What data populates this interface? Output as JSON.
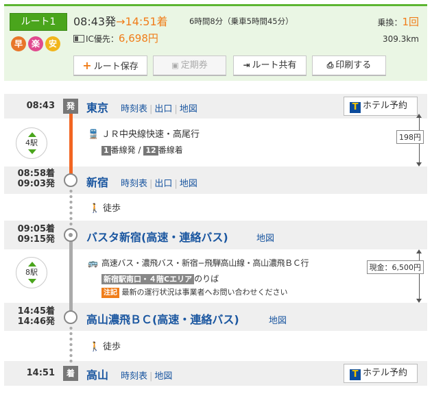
{
  "summary": {
    "route_label": "ルート1",
    "marks": [
      {
        "char": "早",
        "color": "#e8762b"
      },
      {
        "char": "楽",
        "color": "#e04a8e"
      },
      {
        "char": "安",
        "color": "#f1b51c"
      }
    ],
    "depart_time": "08:43発",
    "arrow": "→",
    "arrive_time": "14:51着",
    "duration": "6時間8分（乗車5時間45分）",
    "ic_label": "IC優先：",
    "fare": "6,698円",
    "transfer_label": "乗換：",
    "transfer_count": "1回",
    "distance": "309.3km"
  },
  "actions": {
    "save": "ルート保存",
    "pass": "定期券",
    "share": "ルート共有",
    "print": "印刷する"
  },
  "stations": [
    {
      "time": "08:43",
      "mark": "発",
      "name": "東京",
      "links": [
        "時刻表",
        "出口",
        "地図"
      ],
      "hotel": "ホテル予約"
    },
    {
      "arr": "08:58着",
      "dep": "09:03発",
      "name": "新宿",
      "links": [
        "時刻表",
        "出口",
        "地図"
      ]
    },
    {
      "arr": "09:05着",
      "dep": "09:15発",
      "name": "バスタ新宿(高速・連絡バス)",
      "links": [
        "地図"
      ]
    },
    {
      "arr": "14:45着",
      "dep": "14:46発",
      "name": "高山濃飛ＢＣ(高速・連絡バス)",
      "links": [
        "地図"
      ]
    },
    {
      "time": "14:51",
      "mark": "着",
      "name": "高山",
      "links": [
        "時刻表",
        "地図"
      ],
      "hotel": "ホテル予約"
    }
  ],
  "legs": {
    "train": {
      "stops": "4駅",
      "name": "ＪＲ中央線快速・高尾行",
      "dep_platform": "1",
      "dep_suffix": "番線発",
      "slash": "/",
      "arr_platform": "12",
      "arr_suffix": "番線着",
      "fare": "198円"
    },
    "walk1": "徒歩",
    "bus": {
      "stops": "8駅",
      "name": "高速バス・濃飛バス・新宿−飛騨高山線・高山濃飛ＢＣ行",
      "boarding_tag": "新宿駅南口・４階Cエリア",
      "boarding_suffix": "のりば",
      "notice_tag": "注記",
      "notice": "最新の運行状況は事業者へお問い合わせください",
      "fare": "現金：6,500円"
    },
    "walk2": "徒歩"
  },
  "icons": {
    "plus": "plus-icon",
    "pass": "commuter-pass-icon",
    "share": "share-icon",
    "print": "printer-icon",
    "train": "train-icon",
    "bus": "bus-icon",
    "walk": "walk-icon",
    "hotel": "t-hotel-icon"
  },
  "colors": {
    "accent_green": "#4aa51c",
    "orange": "#f07d1a",
    "link": "#1a56a0",
    "rail_red": "#f26522"
  }
}
